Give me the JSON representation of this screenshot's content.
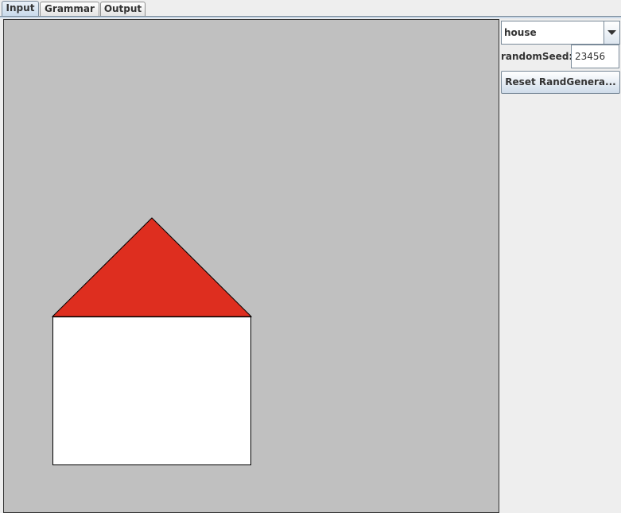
{
  "tabs": [
    {
      "label": "Input",
      "active": true
    },
    {
      "label": "Grammar",
      "active": false
    },
    {
      "label": "Output",
      "active": false
    }
  ],
  "sidebar": {
    "model_select": {
      "value": "house"
    },
    "random_seed": {
      "label": "randomSeed:",
      "value": "23456"
    },
    "reset_button": {
      "label": "Reset RandGenera..."
    }
  },
  "canvas": {
    "background": "#c0c0c0",
    "shapes": [
      {
        "name": "roof-triangle",
        "fill": "#de2e1f"
      },
      {
        "name": "house-body-rectangle",
        "fill": "#ffffff"
      }
    ]
  },
  "colors": {
    "accent": "#c8d7e6",
    "window": "#eeeeee"
  }
}
